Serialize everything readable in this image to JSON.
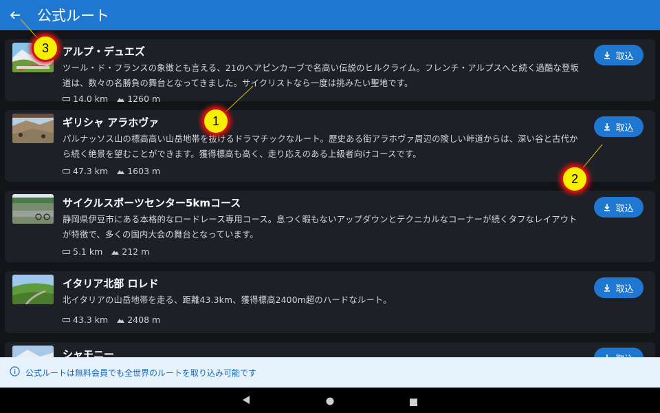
{
  "appbar": {
    "back_icon": "arrow-left-icon",
    "title": "公式ルート"
  },
  "routes": [
    {
      "title": "アルプ・デュエズ",
      "desc": "ツール・ド・フランスの象徴とも言える、21のヘアピンカーブで名高い伝説のヒルクライム。フレンチ・アルプスへと続く過酷な登坂道は、数々の名勝負の舞台となってきました。サイクリストなら一度は挑みたい聖地です。",
      "distance": "14.0 km",
      "elevation": "1260 m",
      "button": "取込"
    },
    {
      "title": "ギリシャ アラホヴァ",
      "desc": "パルナッソス山の標高高い山岳地帯を抜けるドラマチックなルート。歴史ある街アラホヴァ周辺の険しい峠道からは、深い谷と古代から続く絶景を望むことができます。獲得標高も高く、走り応えのある上級者向けコースです。",
      "distance": "47.3 km",
      "elevation": "1603 m",
      "button": "取込"
    },
    {
      "title": "サイクルスポーツセンター5kmコース",
      "desc": "静岡県伊豆市にある本格的なロードレース専用コース。息つく暇もないアップダウンとテクニカルなコーナーが続くタフなレイアウトが特徴で、多くの国内大会の舞台となっています。",
      "distance": "5.1 km",
      "elevation": "212 m",
      "button": "取込"
    },
    {
      "title": "イタリア北部 ロレド",
      "desc": "北イタリアの山岳地帯を走る、距離43.3km、獲得標高2400m超のハードなルート。",
      "distance": "43.3 km",
      "elevation": "2408 m",
      "button": "取込"
    },
    {
      "title": "シャモニー",
      "desc": "",
      "distance": "",
      "elevation": "",
      "button": "取込"
    }
  ],
  "notice": {
    "icon": "info-icon",
    "text": "公式ルートは無料会員でも全世界のルートを取り込み可能です"
  },
  "navbar": {
    "back": "nav-back-icon",
    "home": "nav-home-icon",
    "recents": "nav-recents-icon"
  },
  "callouts": [
    "1",
    "2",
    "3"
  ],
  "colors": {
    "appbar": "#1e78d2",
    "background": "#121418",
    "card": "#1d2027",
    "notice_bg": "#e6f2fc",
    "callout": "#f7ef00"
  }
}
